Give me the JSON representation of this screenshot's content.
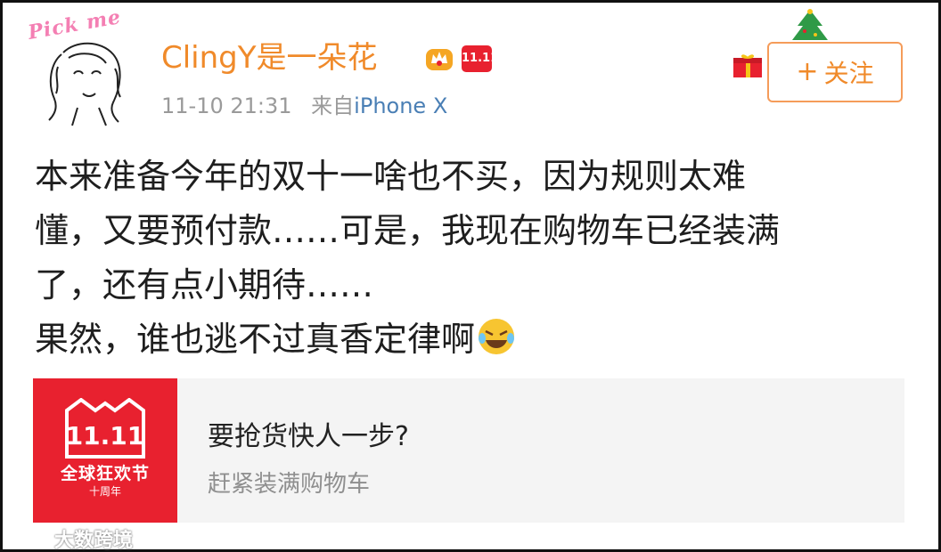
{
  "profile": {
    "avatar_tag": "Pick me",
    "username": "ClingY是一朵花",
    "badge_1111": "11.11"
  },
  "meta": {
    "time": "11-10 21:31",
    "source_prefix": "来自",
    "device": "iPhone X"
  },
  "follow": {
    "plus": "+",
    "label": "关注"
  },
  "post": {
    "lines": [
      "本来准备今年的双十一啥也不买，因为规则太难",
      "懂，又要预付款……可是，我现在购物车已经装满",
      "了，还有点小期待……",
      "果然，谁也逃不过真香定律啊"
    ],
    "emoji": "laugh-cry-emoji"
  },
  "card": {
    "thumb_title": "全球狂欢节",
    "thumb_sub": "十周年",
    "thumb_logo": "11.11",
    "title": "要抢货快人一步?",
    "subtitle": "赶紧装满购物车"
  },
  "watermark": {
    "text": "大数跨境"
  },
  "colors": {
    "accent_orange": "#f08a2a",
    "tmall_red": "#e8212f",
    "link_blue": "#4a7fb5"
  }
}
